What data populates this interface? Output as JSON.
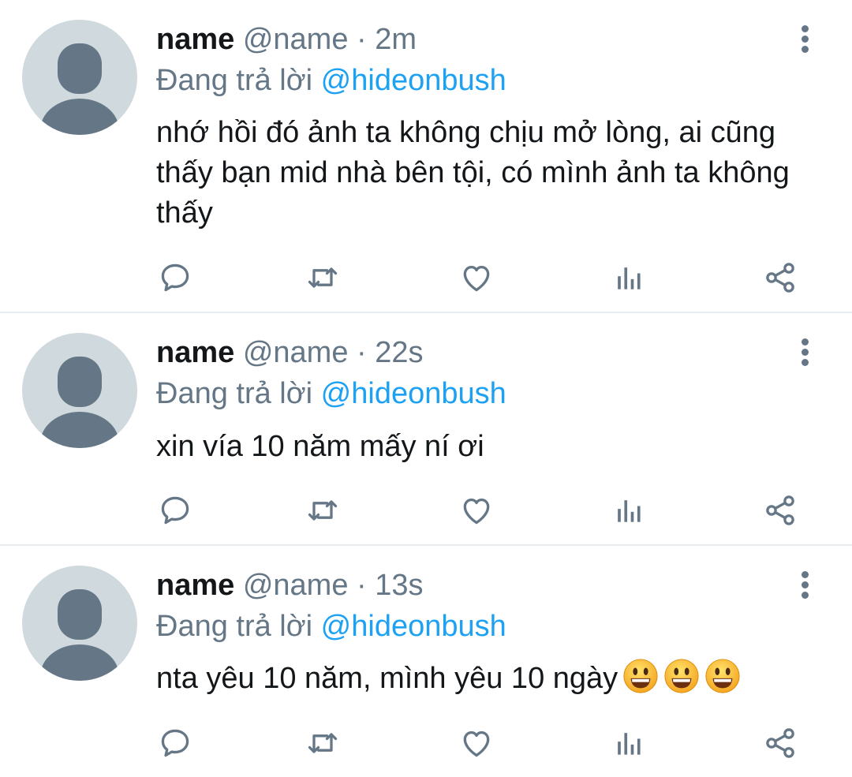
{
  "tweets": [
    {
      "display_name": "name",
      "handle": "@name",
      "separator": "·",
      "time": "2m",
      "reply_prefix": "Đang trả lời",
      "reply_to": "@hideonbush",
      "text": "nhớ hồi đó ảnh ta không chịu mở lòng, ai cũng thấy bạn mid nhà bên tội, có mình ảnh ta không thấy",
      "emojis": []
    },
    {
      "display_name": "name",
      "handle": "@name",
      "separator": "·",
      "time": "22s",
      "reply_prefix": "Đang trả lời",
      "reply_to": "@hideonbush",
      "text": "xin vía 10 năm mấy ní ơi",
      "emojis": []
    },
    {
      "display_name": "name",
      "handle": "@name",
      "separator": "·",
      "time": "13s",
      "reply_prefix": "Đang trả lời",
      "reply_to": "@hideonbush",
      "text": "nta yêu 10 năm, mình yêu 10 ngày",
      "emojis": [
        "grinning-face-emoji",
        "grinning-face-emoji",
        "grinning-face-emoji"
      ]
    }
  ],
  "icons": {
    "reply": "reply-icon",
    "retweet": "retweet-icon",
    "like": "heart-icon",
    "views": "analytics-icon",
    "share": "share-icon",
    "menu": "more-vertical-icon",
    "avatar": "default-avatar-icon"
  },
  "colors": {
    "primary_text": "#14171a",
    "secondary_text": "#657786",
    "link": "#1da1f2",
    "avatar_bg": "#cfd9de",
    "avatar_fg": "#657786",
    "divider": "#e6ecf0"
  }
}
